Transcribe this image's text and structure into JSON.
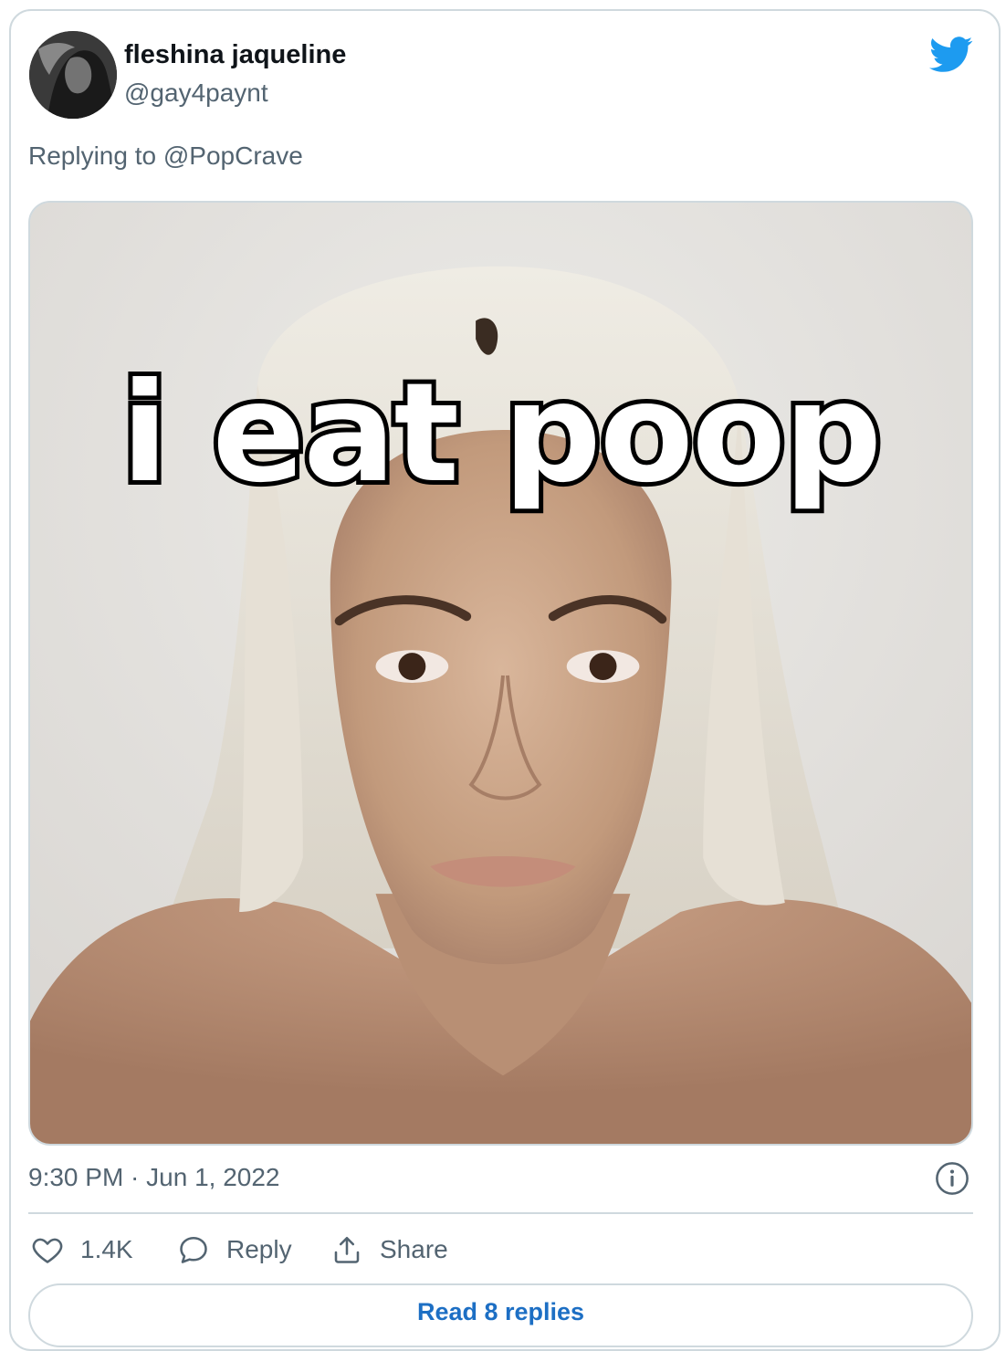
{
  "tweet": {
    "display_name": "fleshina jaqueline",
    "handle": "@gay4paynt",
    "replying_to": "Replying to @PopCrave",
    "media_caption": "i eat poop",
    "timestamp": "9:30 PM · Jun 1, 2022"
  },
  "actions": {
    "like_count": "1.4K",
    "reply_label": "Reply",
    "share_label": "Share",
    "read_replies_label": "Read 8 replies"
  },
  "icons": [
    "twitter-bird-icon",
    "info-icon",
    "heart-icon",
    "reply-bubble-icon",
    "share-icon"
  ],
  "colors": {
    "brand_blue": "#1d9bf0",
    "link_blue": "#1d6fc4",
    "secondary_text": "#536471",
    "border": "#cfd9de"
  }
}
